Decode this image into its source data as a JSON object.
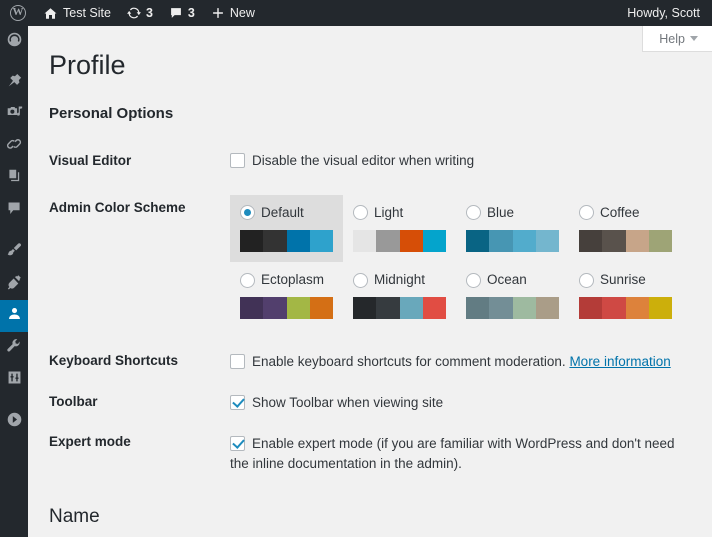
{
  "adminbar": {
    "logo_icon": "wordpress-logo-icon",
    "site_name": "Test Site",
    "updates_icon": "updates-icon",
    "updates_count": "3",
    "comments_icon": "comment-bubble-icon",
    "comments_count": "3",
    "new_icon": "plus-icon",
    "new_label": "New",
    "account_greeting": "Howdy, Scott"
  },
  "help_tab": {
    "label": "Help",
    "toggle_icon": "chevron-down-icon"
  },
  "sidebar": {
    "items": [
      {
        "name": "dashboard",
        "icon": "dashboard-gauge-icon",
        "current": false
      },
      {
        "name": "posts",
        "icon": "pushpin-icon",
        "current": false
      },
      {
        "name": "media",
        "icon": "media-camera-music-icon",
        "current": false
      },
      {
        "name": "links",
        "icon": "chain-link-icon",
        "current": false
      },
      {
        "name": "pages",
        "icon": "pages-stack-icon",
        "current": false
      },
      {
        "name": "comments",
        "icon": "comment-bubble-icon",
        "current": false
      },
      {
        "name": "appearance",
        "icon": "paint-brush-icon",
        "current": false
      },
      {
        "name": "plugins",
        "icon": "plug-icon",
        "current": false
      },
      {
        "name": "users",
        "icon": "user-person-icon",
        "current": true
      },
      {
        "name": "tools",
        "icon": "wrench-icon",
        "current": false
      },
      {
        "name": "settings",
        "icon": "sliders-settings-icon",
        "current": false
      },
      {
        "name": "collapse-menu",
        "icon": "collapse-arrow-icon",
        "current": false
      }
    ]
  },
  "page": {
    "title": "Profile",
    "section_title": "Personal Options",
    "name_section_title": "Name"
  },
  "fields": {
    "visual_editor": {
      "label": "Visual Editor",
      "checkbox_label": "Disable the visual editor when writing",
      "checked": false
    },
    "admin_color_scheme": {
      "label": "Admin Color Scheme"
    },
    "keyboard_shortcuts": {
      "label": "Keyboard Shortcuts",
      "checkbox_label": "Enable keyboard shortcuts for comment moderation.",
      "more_info_link": "More information",
      "checked": false
    },
    "toolbar": {
      "label": "Toolbar",
      "checkbox_label": "Show Toolbar when viewing site",
      "checked": true
    },
    "expert_mode": {
      "label": "Expert mode",
      "checkbox_label": "Enable expert mode (if you are familiar with WordPress and don't need the inline documentation in the admin).",
      "checked": true
    }
  },
  "color_schemes": [
    {
      "id": "default",
      "label": "Default",
      "selected": true,
      "colors": [
        "#222222",
        "#333333",
        "#0073aa",
        "#2ea2cc"
      ]
    },
    {
      "id": "light",
      "label": "Light",
      "selected": false,
      "colors": [
        "#e5e5e5",
        "#999999",
        "#d64e07",
        "#04a4cc"
      ]
    },
    {
      "id": "blue",
      "label": "Blue",
      "selected": false,
      "colors": [
        "#096484",
        "#4796b3",
        "#52accc",
        "#74b6ce"
      ]
    },
    {
      "id": "coffee",
      "label": "Coffee",
      "selected": false,
      "colors": [
        "#46403c",
        "#59524c",
        "#c7a589",
        "#9ea476"
      ]
    },
    {
      "id": "ectoplasm",
      "label": "Ectoplasm",
      "selected": false,
      "colors": [
        "#413256",
        "#523f6d",
        "#a3b745",
        "#d46f15"
      ]
    },
    {
      "id": "midnight",
      "label": "Midnight",
      "selected": false,
      "colors": [
        "#25282b",
        "#363b3f",
        "#69a8bb",
        "#e14d43"
      ]
    },
    {
      "id": "ocean",
      "label": "Ocean",
      "selected": false,
      "colors": [
        "#627c83",
        "#738e96",
        "#9ebaa0",
        "#aa9d88"
      ]
    },
    {
      "id": "sunrise",
      "label": "Sunrise",
      "selected": false,
      "colors": [
        "#b43c38",
        "#cf4944",
        "#dd823b",
        "#ccaf0b"
      ]
    }
  ],
  "colors": {
    "admin_bar_bg": "#23282d",
    "content_bg": "#f1f1f1",
    "accent_blue": "#0073aa",
    "link_blue": "#0073aa"
  }
}
